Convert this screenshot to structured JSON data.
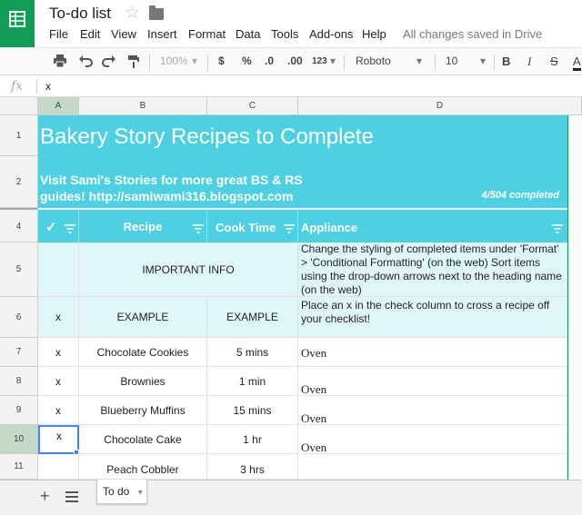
{
  "app": {
    "title": "To-do list",
    "save_status": "All changes saved in Drive",
    "menu": [
      "File",
      "Edit",
      "View",
      "Insert",
      "Format",
      "Data",
      "Tools",
      "Add-ons",
      "Help"
    ]
  },
  "toolbar": {
    "zoom": "100%",
    "currency": "$",
    "percent": "%",
    "decrease_decimals": ".0",
    "increase_decimals": ".00",
    "number_format": "123",
    "font": "Roboto",
    "font_size": "10",
    "bold": "B",
    "italic": "I",
    "strikethrough": "S",
    "text_color": "A"
  },
  "formula_bar": {
    "label": "fx",
    "value": "x"
  },
  "columns": [
    "A",
    "B",
    "C",
    "D"
  ],
  "rows": [
    "1",
    "2",
    "4",
    "5",
    "6",
    "7",
    "8",
    "9",
    "10",
    "11"
  ],
  "sheet": {
    "banner_title": "Bakery Story Recipes to Complete",
    "banner_subtitle": "Visit Sami's Stories for more great BS & RS guides! http://samiwami316.blogspot.com",
    "completed_count": "4/504 completed",
    "headers": {
      "check": "✓",
      "recipe": "Recipe",
      "cook_time": "Cook Time",
      "appliance": "Appliance"
    },
    "info_row": {
      "label": "IMPORTANT INFO",
      "text": "Change the styling of completed items under 'Format' > 'Conditional Formatting' (on the web) Sort items using the drop-down arrows next to the heading name (on the web)"
    },
    "example_row": {
      "check": "x",
      "recipe": "EXAMPLE",
      "cook_time": "EXAMPLE",
      "text": "Place an x in the check column to cross a recipe off your checklist!"
    },
    "recipes": [
      {
        "check": "x",
        "recipe": "Chocolate Cookies",
        "cook_time": "5 mins",
        "appliance": "Oven"
      },
      {
        "check": "x",
        "recipe": "Brownies",
        "cook_time": "1 min",
        "appliance": "Oven"
      },
      {
        "check": "x",
        "recipe": "Blueberry Muffins",
        "cook_time": "15 mins",
        "appliance": "Oven"
      },
      {
        "check": "x",
        "recipe": "Chocolate Cake",
        "cook_time": "1 hr",
        "appliance": "Oven"
      },
      {
        "check": "",
        "recipe": "Peach Cobbler",
        "cook_time": "3 hrs",
        "appliance": ""
      }
    ]
  },
  "tabs": {
    "active": "To do"
  },
  "colors": {
    "banner": "#4dd0e1",
    "light_row": "#e0f7fa",
    "selection": "#4285f4",
    "brand": "#0f9d58"
  }
}
